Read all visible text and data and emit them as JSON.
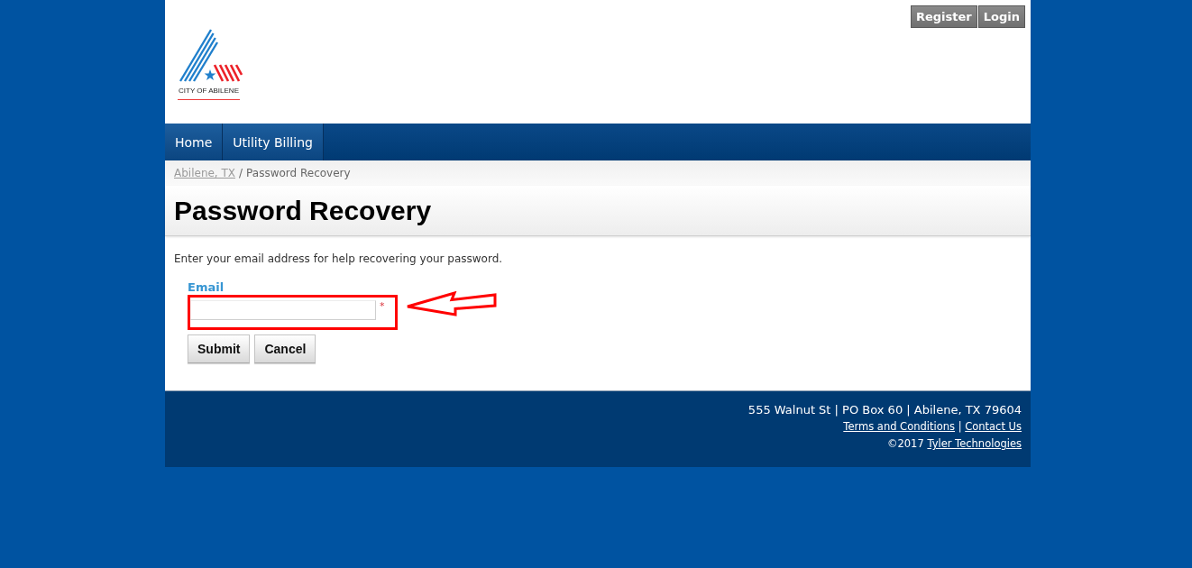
{
  "header": {
    "logo_text": "CITY OF ABILENE",
    "account_links": [
      {
        "label": "Register"
      },
      {
        "label": "Login"
      }
    ]
  },
  "nav": {
    "items": [
      {
        "label": "Home"
      },
      {
        "label": "Utility Billing"
      }
    ]
  },
  "breadcrumb": {
    "items": [
      {
        "label": "Abilene, TX",
        "kind": "link"
      },
      {
        "label": "Password Recovery",
        "kind": "current"
      }
    ],
    "separator": "/"
  },
  "page_title": "Password Recovery",
  "form": {
    "instructions": "Enter your email address for help recovering your password.",
    "email_field": {
      "label": "Email",
      "required_mark": "*"
    },
    "buttons": [
      {
        "label": "Submit"
      },
      {
        "label": "Cancel"
      }
    ]
  },
  "footer": {
    "address": "555 Walnut St | PO Box 60 | Abilene, TX 79604",
    "links": [
      {
        "label": "Terms and Conditions"
      },
      {
        "label": "Contact Us"
      }
    ],
    "link_separator": "|",
    "copyright": "©2017",
    "company_link": "Tyler Technologies"
  }
}
